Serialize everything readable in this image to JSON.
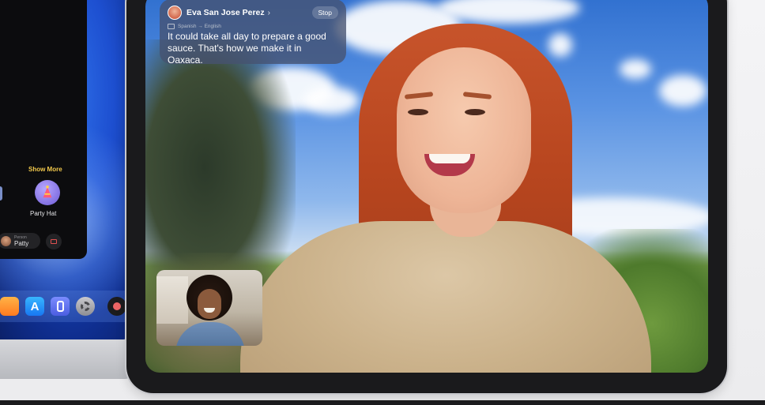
{
  "mac": {
    "show_more_label": "Show More",
    "party_hat_label": "Party Hat",
    "person_chip": {
      "type_label": "Person",
      "name": "Patty"
    }
  },
  "caption": {
    "speaker_name": "Eva San Jose Perez",
    "chevron": "›",
    "stop_label": "Stop",
    "language_pair": "Spanish → English",
    "text": "It could take all day to prepare a good sauce. That's how we make it in Oaxaca."
  },
  "icons": [
    "party-hat-icon",
    "app-store-icon",
    "settings-icon",
    "camera-icon",
    "translate-icon"
  ]
}
